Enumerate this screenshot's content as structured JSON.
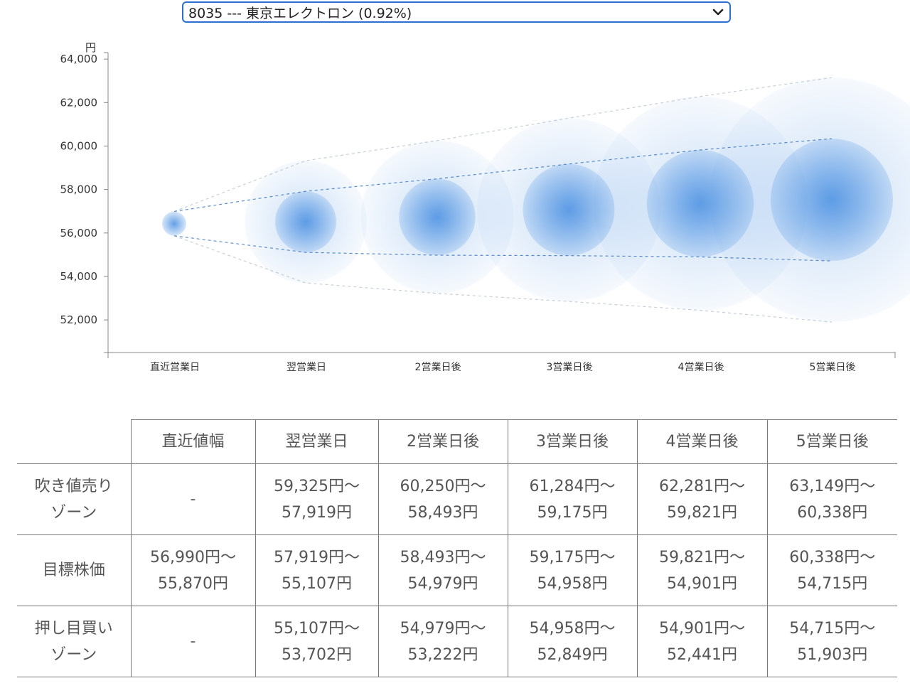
{
  "selector": {
    "value": "8035 --- 東京エレクトロン (0.92%)"
  },
  "colors": {
    "bubble": "#4a90e2",
    "trend": "#4a80c8",
    "axis": "#888888",
    "border": "#777777"
  },
  "chart_data": {
    "type": "scatter",
    "unit_label": "円",
    "categories": [
      "直近営業日",
      "翌営業日",
      "2営業日後",
      "3営業日後",
      "4営業日後",
      "5営業日後"
    ],
    "ylim": [
      50500,
      64300
    ],
    "y_ticks": [
      "64,000",
      "62,000",
      "60,000",
      "58,000",
      "56,000",
      "54,000",
      "52,000"
    ],
    "y_tick_values": [
      64000,
      62000,
      60000,
      58000,
      56000,
      54000,
      52000
    ],
    "center": [
      56430,
      56513,
      56736,
      57067,
      57361,
      57527
    ],
    "target_upper": [
      56990,
      57919,
      58493,
      59175,
      59821,
      60338
    ],
    "target_lower": [
      55870,
      55107,
      54979,
      54958,
      54901,
      54715
    ],
    "outer_upper": [
      56990,
      59325,
      60250,
      61284,
      62281,
      63149
    ],
    "outer_lower": [
      55870,
      53702,
      53222,
      52849,
      52441,
      51903
    ],
    "grid": false
  },
  "table": {
    "headers": [
      "",
      "直近値幅",
      "翌営業日",
      "2営業日後",
      "3営業日後",
      "4営業日後",
      "5営業日後"
    ],
    "rows": [
      {
        "label": [
          "吹き値売り",
          "ゾーン"
        ],
        "cells": [
          [
            "-"
          ],
          [
            "59,325円〜",
            "57,919円"
          ],
          [
            "60,250円〜",
            "58,493円"
          ],
          [
            "61,284円〜",
            "59,175円"
          ],
          [
            "62,281円〜",
            "59,821円"
          ],
          [
            "63,149円〜",
            "60,338円"
          ]
        ]
      },
      {
        "label": [
          "目標株価"
        ],
        "cells": [
          [
            "56,990円〜",
            "55,870円"
          ],
          [
            "57,919円〜",
            "55,107円"
          ],
          [
            "58,493円〜",
            "54,979円"
          ],
          [
            "59,175円〜",
            "54,958円"
          ],
          [
            "59,821円〜",
            "54,901円"
          ],
          [
            "60,338円〜",
            "54,715円"
          ]
        ]
      },
      {
        "label": [
          "押し目買い",
          "ゾーン"
        ],
        "cells": [
          [
            "-"
          ],
          [
            "55,107円〜",
            "53,702円"
          ],
          [
            "54,979円〜",
            "53,222円"
          ],
          [
            "54,958円〜",
            "52,849円"
          ],
          [
            "54,901円〜",
            "52,441円"
          ],
          [
            "54,715円〜",
            "51,903円"
          ]
        ]
      }
    ]
  }
}
